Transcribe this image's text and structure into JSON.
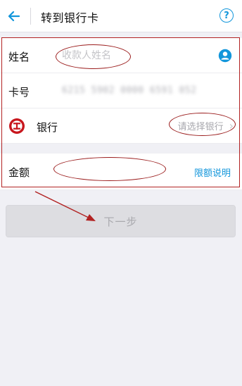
{
  "header": {
    "title": "转到银行卡",
    "help_symbol": "?"
  },
  "form": {
    "name": {
      "label": "姓名",
      "placeholder": "收款人姓名"
    },
    "card": {
      "label": "卡号",
      "masked_value": "6215 5902 0000 6591 052"
    },
    "bank": {
      "label": "银行",
      "placeholder": "请选择银行"
    },
    "amount": {
      "label": "金额",
      "limit_link": "限额说明"
    }
  },
  "next_button": {
    "label": "下一步"
  },
  "colors": {
    "accent": "#1296db",
    "bank_icon": "#c8161d",
    "annotation": "#b22222"
  },
  "icons": {
    "back": "arrow-left-icon",
    "help": "question-circle-icon",
    "contact": "contact-person-icon",
    "bank": "icbc-bank-logo-icon",
    "chevron": "chevron-right-icon"
  }
}
